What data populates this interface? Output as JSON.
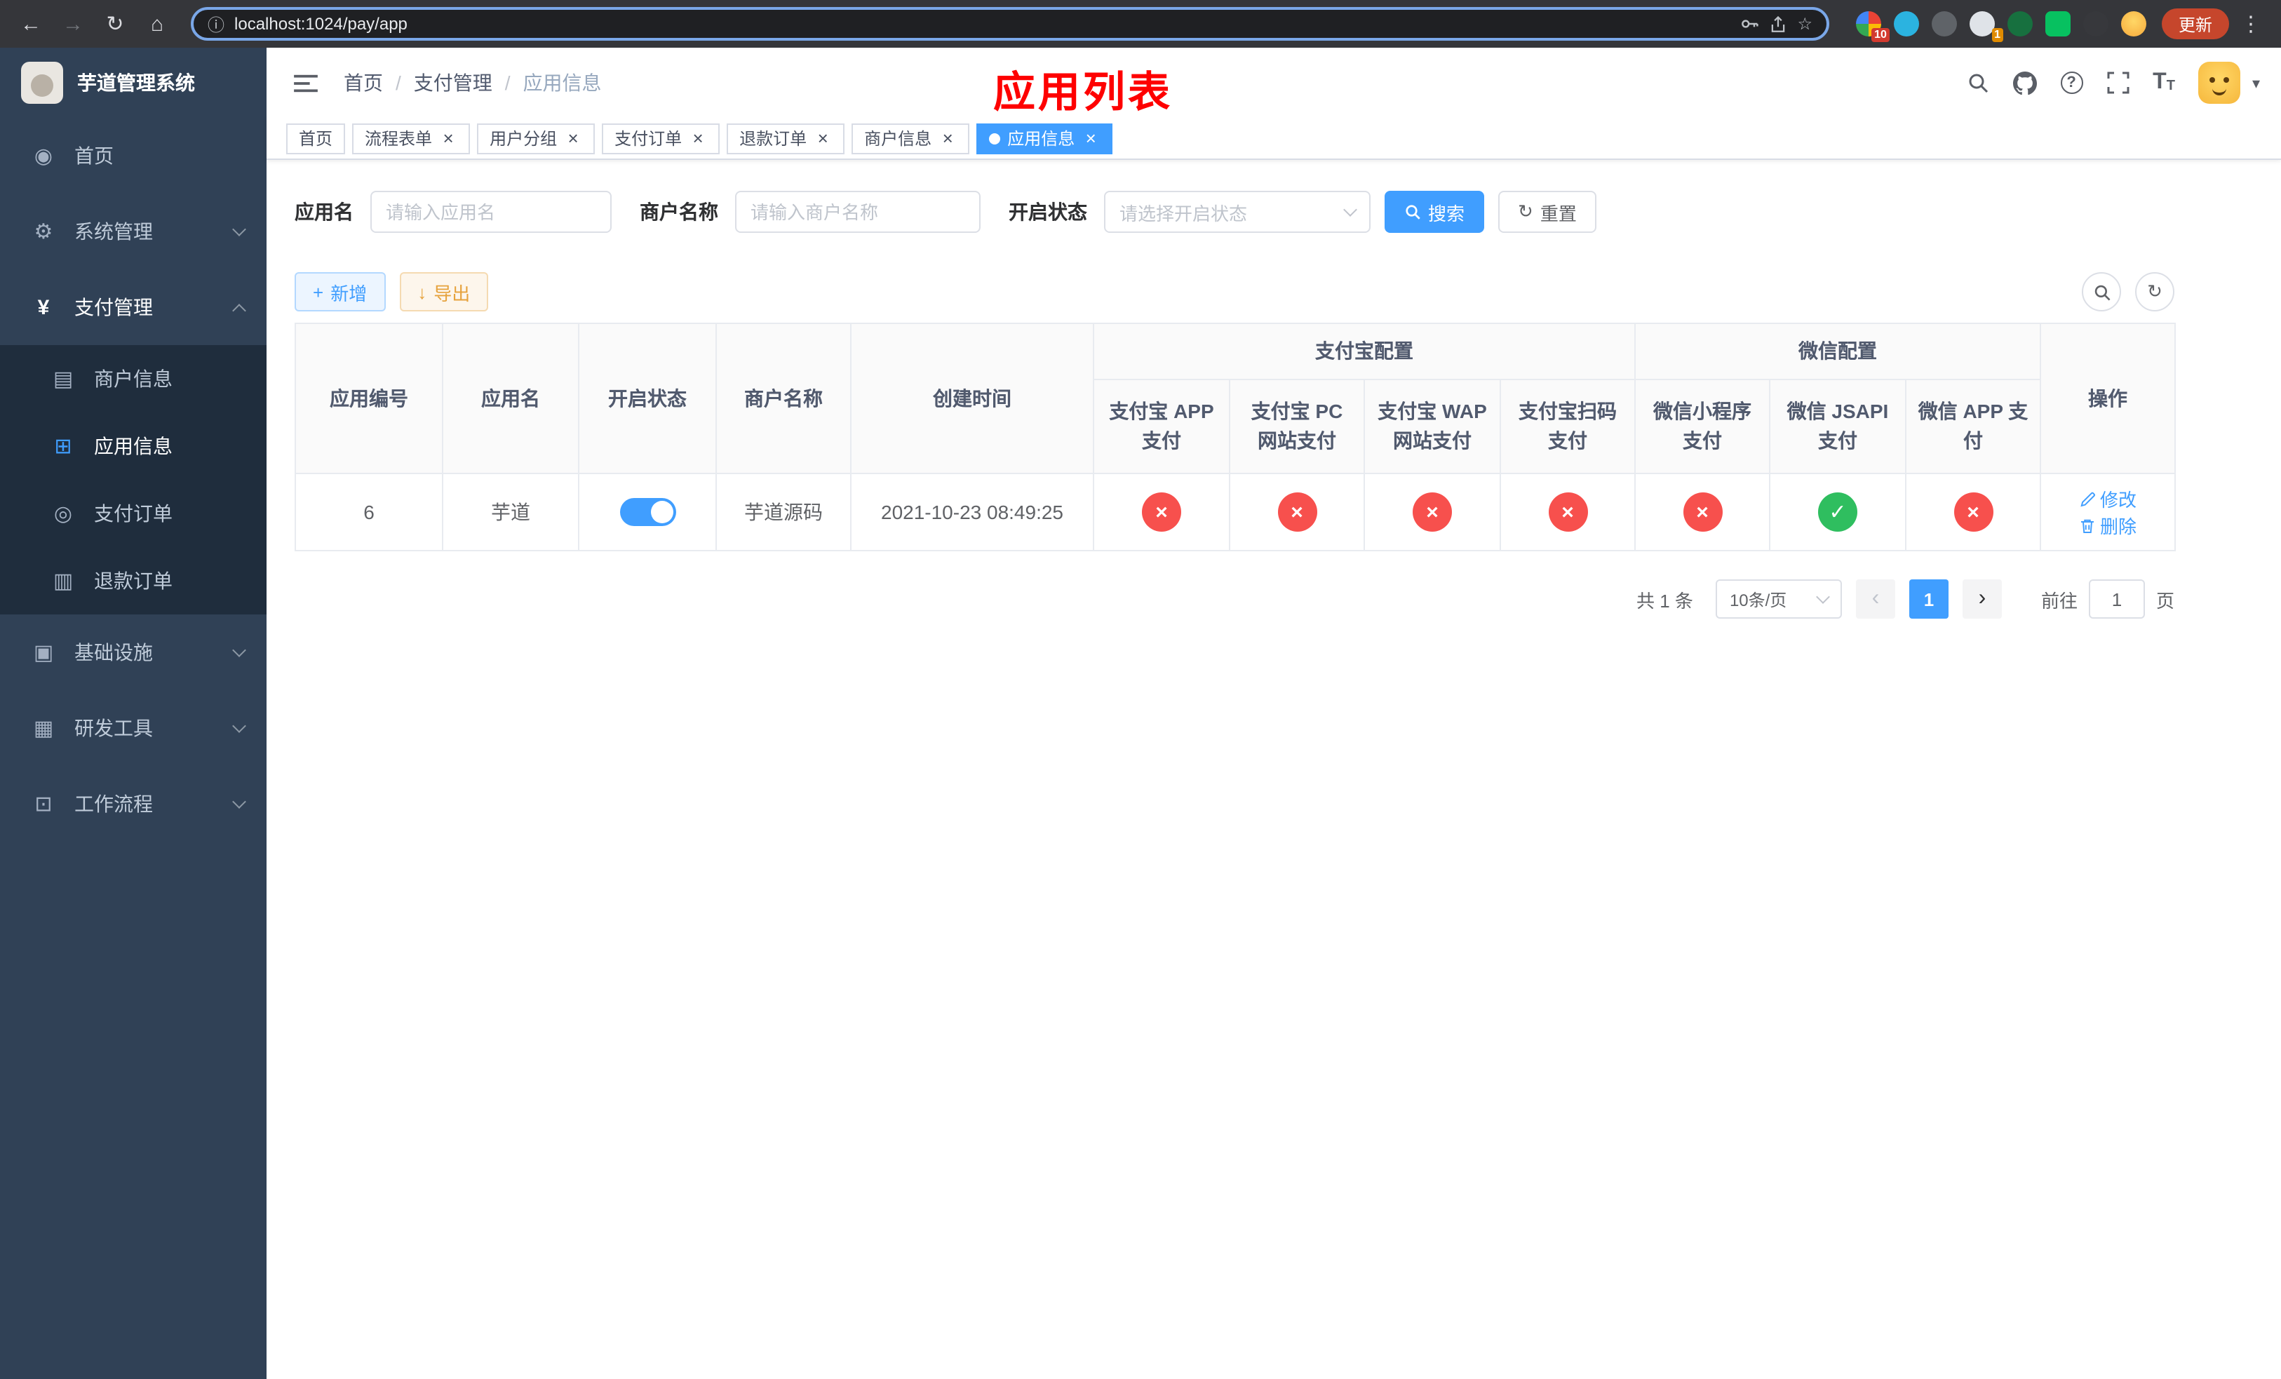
{
  "colors": {
    "accent": "#409eff",
    "danger": "#f7504d",
    "success": "#2fbe5f",
    "warning": "#e6a23c",
    "annotation": "#fe0000",
    "sidebar_bg": "#304156",
    "sidebar_sub_bg": "#1f2d3d"
  },
  "icons": {
    "back": "←",
    "forward": "→",
    "reload": "↻",
    "home": "⌂",
    "info": "ⓘ",
    "star": "☆",
    "kebab": "⋮",
    "question": "?",
    "font_large": "T",
    "font_small": "T",
    "caret_down": "▾",
    "plus": "+",
    "download": "↓",
    "refresh": "↻",
    "check": "✓",
    "cross": "×",
    "close": "×",
    "prev": "‹",
    "next": "›",
    "breadcrumb_sep": "/",
    "menu_home": "◉",
    "menu_system": "⚙",
    "menu_pay": "¥",
    "menu_merchant": "▤",
    "menu_app": "⊞",
    "menu_order": "◎",
    "menu_refund": "▥",
    "menu_infra": "▣",
    "menu_dev": "▦",
    "menu_flow": "⊡"
  },
  "browser": {
    "url": "localhost:1024/pay/app",
    "update_label": "更新",
    "extension_badges": {
      "grid": "10",
      "green": "1"
    }
  },
  "sidebar": {
    "logo_title": "芋道管理系统",
    "items": {
      "home": "首页",
      "system": "系统管理",
      "payment": "支付管理",
      "merchant": "商户信息",
      "app": "应用信息",
      "pay_order": "支付订单",
      "refund_order": "退款订单",
      "infra": "基础设施",
      "devtools": "研发工具",
      "workflow": "工作流程"
    }
  },
  "navbar": {
    "breadcrumb": [
      "首页",
      "支付管理",
      "应用信息"
    ],
    "overlay_title": "应用列表"
  },
  "tabs": [
    "首页",
    "流程表单",
    "用户分组",
    "支付订单",
    "退款订单",
    "商户信息",
    "应用信息"
  ],
  "filters": {
    "app_name_label": "应用名",
    "app_name_placeholder": "请输入应用名",
    "merchant_label": "商户名称",
    "merchant_placeholder": "请输入商户名称",
    "status_label": "开启状态",
    "status_placeholder": "请选择开启状态",
    "search_label": "搜索",
    "reset_label": "重置"
  },
  "toolbar": {
    "add_label": "新增",
    "export_label": "导出"
  },
  "table": {
    "headers": [
      "应用编号",
      "应用名",
      "开启状态",
      "商户名称",
      "创建时间"
    ],
    "groups": {
      "alipay": "支付宝配置",
      "wechat": "微信配置"
    },
    "alipay_cols": [
      "支付宝 APP 支付",
      "支付宝 PC 网站支付",
      "支付宝 WAP 网站支付",
      "支付宝扫码支付"
    ],
    "wechat_cols": [
      "微信小程序支付",
      "微信 JSAPI 支付",
      "微信 APP 支付"
    ],
    "action_header": "操作",
    "row": {
      "id": "6",
      "name": "芋道",
      "enabled": true,
      "merchant": "芋道源码",
      "created_at": "2021-10-23 08:49:25",
      "channels": [
        false,
        false,
        false,
        false,
        false,
        true,
        false
      ],
      "edit_label": "修改",
      "delete_label": "删除"
    }
  },
  "pagination": {
    "total": "共 1 条",
    "page_size": "10条/页",
    "page": "1",
    "goto_label": "前往",
    "goto_value": "1",
    "goto_unit": "页"
  }
}
